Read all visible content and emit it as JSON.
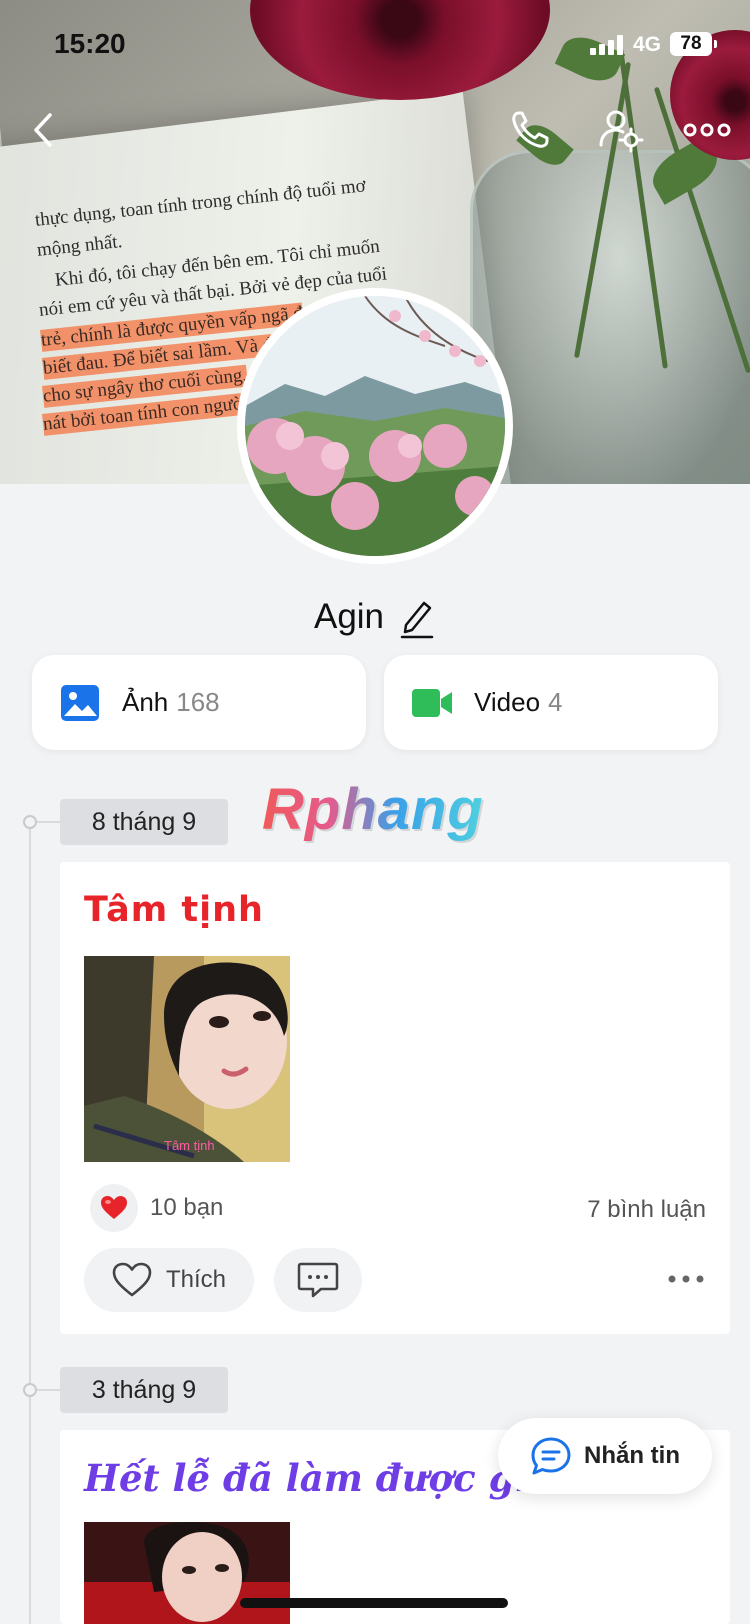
{
  "status_bar": {
    "time": "15:20",
    "network": "4G",
    "battery": "78"
  },
  "cover_text": [
    "thực dụng, toan tính trong chính độ tuổi mơ",
    "mộng nhất.",
    "Khi đó, tôi chạy đến bên em. Tôi chỉ muốn",
    "nói em cứ yêu và thất bại. Bởi vẻ đẹp của tuổi",
    "trẻ, chính là được quyền vấp ngã đ",
    "biết đau. Để biết sai lầm. Và đ",
    "cho sự ngây thơ cuối cùng,",
    "nát bởi toan tính con ngườ"
  ],
  "profile": {
    "name": "Agin"
  },
  "media": {
    "photos": {
      "label": "Ảnh",
      "count": "168",
      "icon": "image-icon"
    },
    "videos": {
      "label": "Video",
      "count": "4",
      "icon": "video-camera-icon"
    }
  },
  "watermark": "Rphang",
  "timeline": [
    {
      "date": "8 tháng 9",
      "post": {
        "title": "Tâm tịnh",
        "photo_caption": "Tâm tịnh",
        "reaction_count": "10 bạn",
        "comment_count": "7 bình luận",
        "like_label": "Thích"
      }
    },
    {
      "date": "3 tháng 9",
      "post": {
        "title": "Hết lễ đã làm được gì"
      }
    }
  ],
  "message_button": {
    "label": "Nhắn tin"
  },
  "colors": {
    "accent_blue": "#1a73e8",
    "video_green": "#2ebd59",
    "title_red": "#e8242b",
    "title_purple": "#6e3de6"
  }
}
